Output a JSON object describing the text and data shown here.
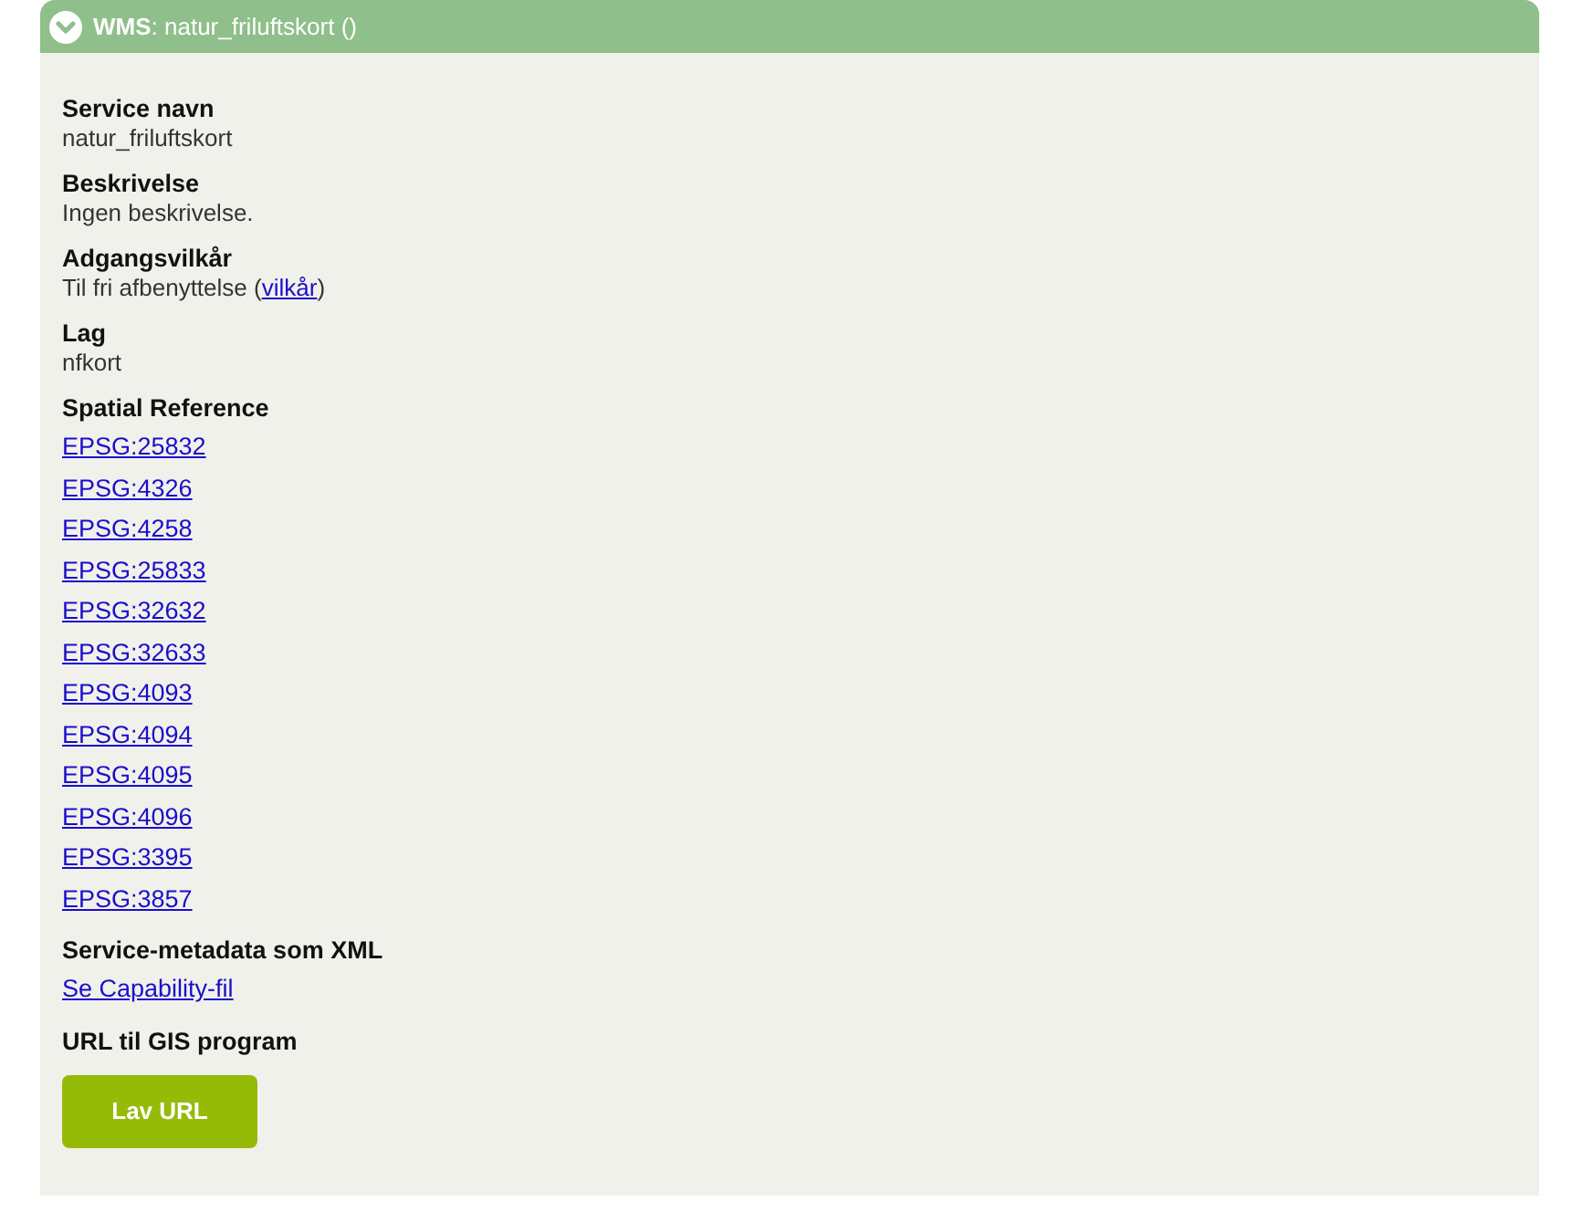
{
  "header": {
    "expanded": true,
    "type": "WMS",
    "title": ": natur_friluftskort ()"
  },
  "sections": [
    {
      "label": "Service navn",
      "kind": "text",
      "value": "natur_friluftskort"
    },
    {
      "label": "Beskrivelse",
      "kind": "text",
      "value": "Ingen beskrivelse."
    },
    {
      "label": "Adgangsvilkår",
      "kind": "text_link",
      "before": "Til fri afbenyttelse (",
      "link": "vilkår",
      "after": ")"
    },
    {
      "label": "Lag",
      "kind": "text",
      "value": "nfkort"
    },
    {
      "label": "Spatial Reference",
      "kind": "links",
      "links": [
        "EPSG:25832",
        "EPSG:4326",
        "EPSG:4258",
        "EPSG:25833",
        "EPSG:32632",
        "EPSG:32633",
        "EPSG:4093",
        "EPSG:4094",
        "EPSG:4095",
        "EPSG:4096",
        "EPSG:3395",
        "EPSG:3857"
      ]
    },
    {
      "label": "Service-metadata som XML",
      "kind": "links",
      "links": [
        "Se Capability-fil"
      ]
    },
    {
      "label": "URL til GIS program",
      "kind": "button",
      "button": "Lav URL"
    }
  ]
}
